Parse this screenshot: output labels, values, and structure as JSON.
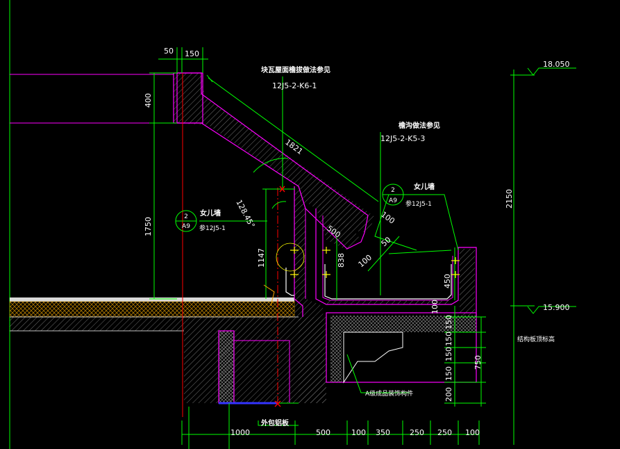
{
  "colors": {
    "background": "#000000",
    "dimension": "#00ff00",
    "wall_outline": "#ff00ff",
    "hatch": "#808080",
    "axis_red": "#ff0000",
    "text": "#ffffff",
    "marker_yellow": "#ffff00",
    "insulation_orange": "#ffa500",
    "foil_blue": "#3333ff"
  },
  "notes": {
    "tile_roof_ref_title": "块瓦屋面檐拔做法参见",
    "tile_roof_ref_code": "12J5-2-K6-1",
    "gutter_ref_title": "檐沟做法参见",
    "gutter_ref_code": "12J5-2-K5-3",
    "parapet_left_label": "女儿墙",
    "parapet_left_ref": "参12J5-1",
    "parapet_right_label": "女儿墙",
    "parapet_right_ref": "参12J5-1",
    "decor_component": "A级成品装饰构件",
    "aluminum_panel": "外包铝板",
    "structural_elevation_label": "结构板顶标高"
  },
  "callouts": {
    "left": {
      "num": "2",
      "sheet": "A9"
    },
    "right": {
      "num": "2",
      "sheet": "A9"
    }
  },
  "elevations": {
    "top": "18.050",
    "middle": "15.900"
  },
  "dimensions": {
    "d50": "50",
    "d150_top": "150",
    "d400": "400",
    "d1750": "1750",
    "d1821": "1821",
    "d128": "128.45°",
    "d1147": "1147",
    "d500_slope": "500",
    "d100_slope": "100",
    "d838": "838",
    "d100_a": "100",
    "d50_a": "50",
    "d450": "450",
    "d100_r": "100",
    "d150_r1": "150",
    "d150_r2": "150",
    "d150_r3": "150",
    "d150_r4": "150",
    "d200": "200",
    "d750": "750",
    "d2150": "2150",
    "b1000": "1000",
    "b500": "500",
    "b100": "100",
    "b350": "350",
    "b250a": "250",
    "b250b": "250",
    "b100b": "100"
  }
}
